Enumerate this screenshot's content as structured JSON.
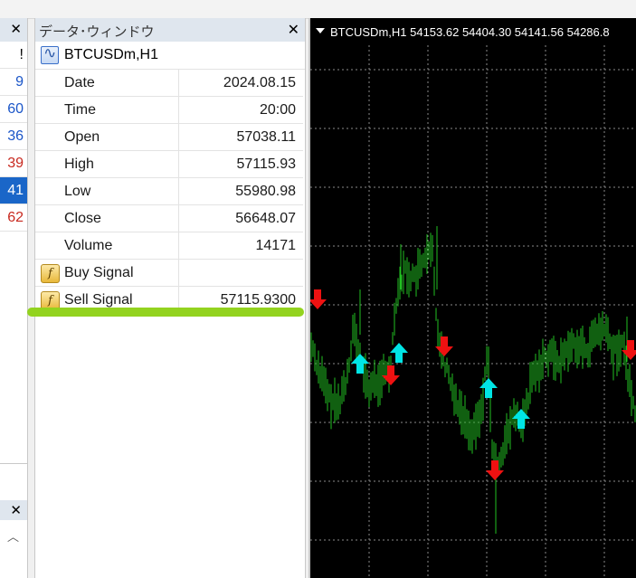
{
  "market_watch": {
    "rows": [
      "!",
      "9",
      "60",
      "36",
      "39",
      "41",
      "62"
    ]
  },
  "data_window": {
    "title": "データ･ウィンドウ",
    "symbol": "BTCUSDm,H1",
    "rows": [
      {
        "label": "Date",
        "value": "2024.08.15"
      },
      {
        "label": "Time",
        "value": "20:00"
      },
      {
        "label": "Open",
        "value": "57038.11"
      },
      {
        "label": "High",
        "value": "57115.93"
      },
      {
        "label": "Low",
        "value": "55980.98"
      },
      {
        "label": "Close",
        "value": "56648.07"
      },
      {
        "label": "Volume",
        "value": "14171"
      }
    ],
    "signals": [
      {
        "label": "Buy Signal",
        "value": ""
      },
      {
        "label": "Sell Signal",
        "value": "57115.9300"
      }
    ]
  },
  "chart": {
    "header": "BTCUSDm,H1  54153.62 54404.30 54141.56 54286.8",
    "colors": {
      "background": "#000000",
      "bars": "#22c022",
      "buy_arrow": "#00e5e5",
      "sell_arrow": "#ee1111"
    }
  }
}
